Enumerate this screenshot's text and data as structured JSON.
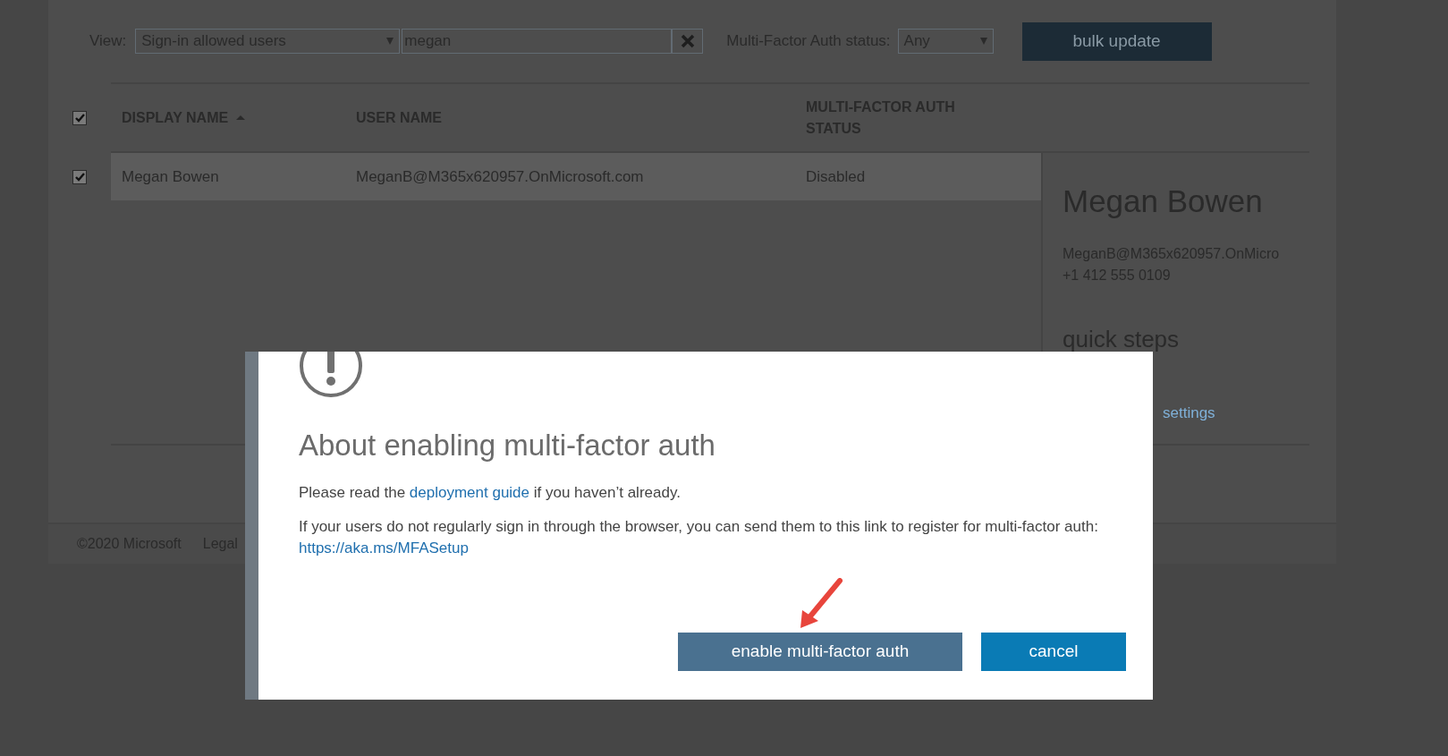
{
  "toolbar": {
    "view_label": "View:",
    "view_select": "Sign-in allowed users",
    "search": {
      "value": "megan"
    },
    "mfa_label": "Multi-Factor Auth status:",
    "mfa_select": "Any",
    "bulk_button": "bulk update"
  },
  "table": {
    "select_all_checked": true,
    "columns": [
      {
        "label": "DISPLAY NAME",
        "sorted": true
      },
      {
        "label": "USER NAME",
        "sorted": false
      },
      {
        "label": "MULTI-FACTOR AUTH STATUS",
        "sorted": false
      }
    ],
    "rows": [
      {
        "checked": true,
        "selected": true,
        "cells": [
          "Megan Bowen",
          "MeganB@M365x620957.OnMicrosoft.com",
          "Disabled"
        ]
      }
    ]
  },
  "details": {
    "name": "Megan Bowen",
    "email": "MeganB@M365x620957.OnMicro",
    "phone": "+1 412 555 0109",
    "quick_steps_title": "quick steps",
    "link": "settings"
  },
  "footer": [
    "©2020 Microsoft",
    "Legal"
  ],
  "dialog": {
    "title": "About enabling multi-factor auth",
    "paragraphs": [
      {
        "before": "Please read the ",
        "link": "deployment guide",
        "after": " if you haven’t already."
      },
      {
        "before": "If your users do not regularly sign in through the browser, you can send them to this link to register for multi-factor auth: ",
        "link": "https://aka.ms/MFASetup"
      }
    ],
    "buttons": [
      {
        "label": "enable multi-factor auth",
        "kind": "primary"
      },
      {
        "label": "cancel",
        "kind": "secondary"
      }
    ]
  }
}
